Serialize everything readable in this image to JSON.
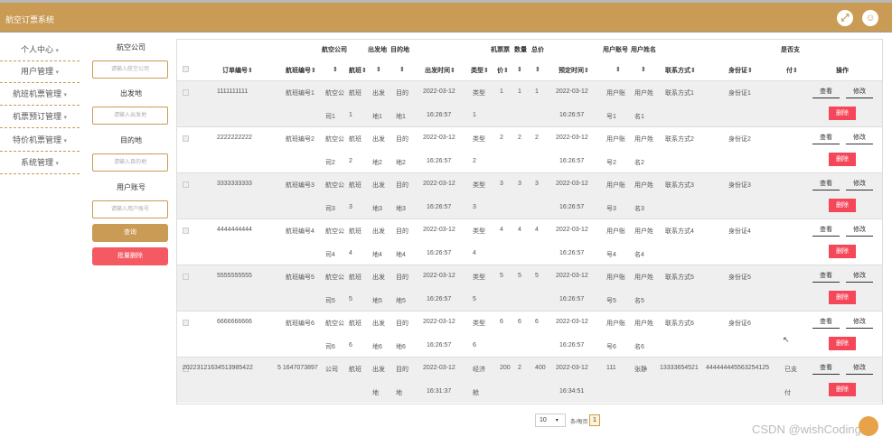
{
  "app": {
    "title": "航空订票系统"
  },
  "header_icons": {
    "fullscreen": "fullscreen-icon",
    "user": "user-icon"
  },
  "sidebar": {
    "items": [
      {
        "label": "个人中心"
      },
      {
        "label": "用户管理"
      },
      {
        "label": "航班机票管理"
      },
      {
        "label": "机票预订管理"
      },
      {
        "label": "特价机票管理"
      },
      {
        "label": "系统管理"
      }
    ]
  },
  "filter": {
    "airline_label": "航空公司",
    "airline_placeholder": "请输入航空公司",
    "departure_label": "出发地",
    "departure_placeholder": "请输入出发地",
    "destination_label": "目的地",
    "destination_placeholder": "请输入目的地",
    "account_label": "用户账号",
    "account_placeholder": "请输入用户账号",
    "query_label": "查询",
    "batch_delete_label": "批量删除"
  },
  "table": {
    "top_headers": [
      "航空公司",
      "出发地",
      "目的地",
      "机票票",
      "数量",
      "总价",
      "用户账号",
      "用户姓名",
      "是否支"
    ],
    "headers": [
      "订单编号",
      "航班编号",
      "航班",
      "出发时间",
      "类型",
      "价",
      "预定时间",
      "联系方式",
      "身份证",
      "付",
      "操作"
    ],
    "view_label": "查看",
    "edit_label": "修改",
    "delete_label": "删除",
    "rows": [
      {
        "order": "1111111111",
        "flight_no": "航班编号1",
        "airline": [
          "航空公",
          "司1"
        ],
        "flight": [
          "航班",
          "1"
        ],
        "dep": [
          "出发",
          "地1"
        ],
        "dest": [
          "目的",
          "地1"
        ],
        "date": "2022-03-12",
        "time": "16:26:57",
        "type": [
          "类型",
          "1"
        ],
        "price": "1",
        "qty": "1",
        "total": "1",
        "book_date": "2022-03-12",
        "book_time": "16:26:57",
        "account": [
          "用户账",
          "号1"
        ],
        "name": [
          "用户姓",
          "名1"
        ],
        "contact": "联系方式1",
        "id_card": "身份证1",
        "paid": [
          "",
          ""
        ]
      },
      {
        "order": "2222222222",
        "flight_no": "航班编号2",
        "airline": [
          "航空公",
          "司2"
        ],
        "flight": [
          "航班",
          "2"
        ],
        "dep": [
          "出发",
          "地2"
        ],
        "dest": [
          "目的",
          "地2"
        ],
        "date": "2022-03-12",
        "time": "16:26:57",
        "type": [
          "类型",
          "2"
        ],
        "price": "2",
        "qty": "2",
        "total": "2",
        "book_date": "2022-03-12",
        "book_time": "16:26:57",
        "account": [
          "用户账",
          "号2"
        ],
        "name": [
          "用户姓",
          "名2"
        ],
        "contact": "联系方式2",
        "id_card": "身份证2",
        "paid": [
          "",
          ""
        ]
      },
      {
        "order": "3333333333",
        "flight_no": "航班编号3",
        "airline": [
          "航空公",
          "司3"
        ],
        "flight": [
          "航班",
          "3"
        ],
        "dep": [
          "出发",
          "地3"
        ],
        "dest": [
          "目的",
          "地3"
        ],
        "date": "2022-03-12",
        "time": "16:26:57",
        "type": [
          "类型",
          "3"
        ],
        "price": "3",
        "qty": "3",
        "total": "3",
        "book_date": "2022-03-12",
        "book_time": "16:26:57",
        "account": [
          "用户账",
          "号3"
        ],
        "name": [
          "用户姓",
          "名3"
        ],
        "contact": "联系方式3",
        "id_card": "身份证3",
        "paid": [
          "",
          ""
        ]
      },
      {
        "order": "4444444444",
        "flight_no": "航班编号4",
        "airline": [
          "航空公",
          "司4"
        ],
        "flight": [
          "航班",
          "4"
        ],
        "dep": [
          "出发",
          "地4"
        ],
        "dest": [
          "目的",
          "地4"
        ],
        "date": "2022-03-12",
        "time": "16:26:57",
        "type": [
          "类型",
          "4"
        ],
        "price": "4",
        "qty": "4",
        "total": "4",
        "book_date": "2022-03-12",
        "book_time": "16:26:57",
        "account": [
          "用户账",
          "号4"
        ],
        "name": [
          "用户姓",
          "名4"
        ],
        "contact": "联系方式4",
        "id_card": "身份证4",
        "paid": [
          "",
          ""
        ]
      },
      {
        "order": "5555555555",
        "flight_no": "航班编号5",
        "airline": [
          "航空公",
          "司5"
        ],
        "flight": [
          "航班",
          "5"
        ],
        "dep": [
          "出发",
          "地5"
        ],
        "dest": [
          "目的",
          "地5"
        ],
        "date": "2022-03-12",
        "time": "16:26:57",
        "type": [
          "类型",
          "5"
        ],
        "price": "5",
        "qty": "5",
        "total": "5",
        "book_date": "2022-03-12",
        "book_time": "16:26:57",
        "account": [
          "用户账",
          "号5"
        ],
        "name": [
          "用户姓",
          "名5"
        ],
        "contact": "联系方式5",
        "id_card": "身份证5",
        "paid": [
          "",
          ""
        ]
      },
      {
        "order": "6666666666",
        "flight_no": "航班编号6",
        "airline": [
          "航空公",
          "司6"
        ],
        "flight": [
          "航班",
          "6"
        ],
        "dep": [
          "出发",
          "地6"
        ],
        "dest": [
          "目的",
          "地6"
        ],
        "date": "2022-03-12",
        "time": "16:26:57",
        "type": [
          "类型",
          "6"
        ],
        "price": "6",
        "qty": "6",
        "total": "6",
        "book_date": "2022-03-12",
        "book_time": "16:26:57",
        "account": [
          "用户账",
          "号6"
        ],
        "name": [
          "用户姓",
          "名6"
        ],
        "contact": "联系方式6",
        "id_card": "身份证6",
        "paid": [
          "",
          ""
        ]
      },
      {
        "order": "20223121634513985422",
        "flight_no": "5 1647073897",
        "airline": [
          "公司",
          ""
        ],
        "flight": [
          "航班",
          ""
        ],
        "dep": [
          "出发",
          "地"
        ],
        "dest": [
          "目的",
          "地"
        ],
        "date": "2022-03-12",
        "time": "16:31:37",
        "type": [
          "经济",
          "舱"
        ],
        "price": "200",
        "qty": "2",
        "total": "400",
        "book_date": "2022-03-12",
        "book_time": "16:34:51",
        "account": [
          "111",
          ""
        ],
        "name": [
          "张静",
          ""
        ],
        "contact": "13333654521",
        "id_card": "444444445563254125",
        "paid": [
          "已支",
          "付"
        ]
      }
    ]
  },
  "pager": {
    "page_size": "10",
    "per_page_label": "条/每页",
    "current_page": "1"
  },
  "watermark": "CSDN @wishCoding"
}
